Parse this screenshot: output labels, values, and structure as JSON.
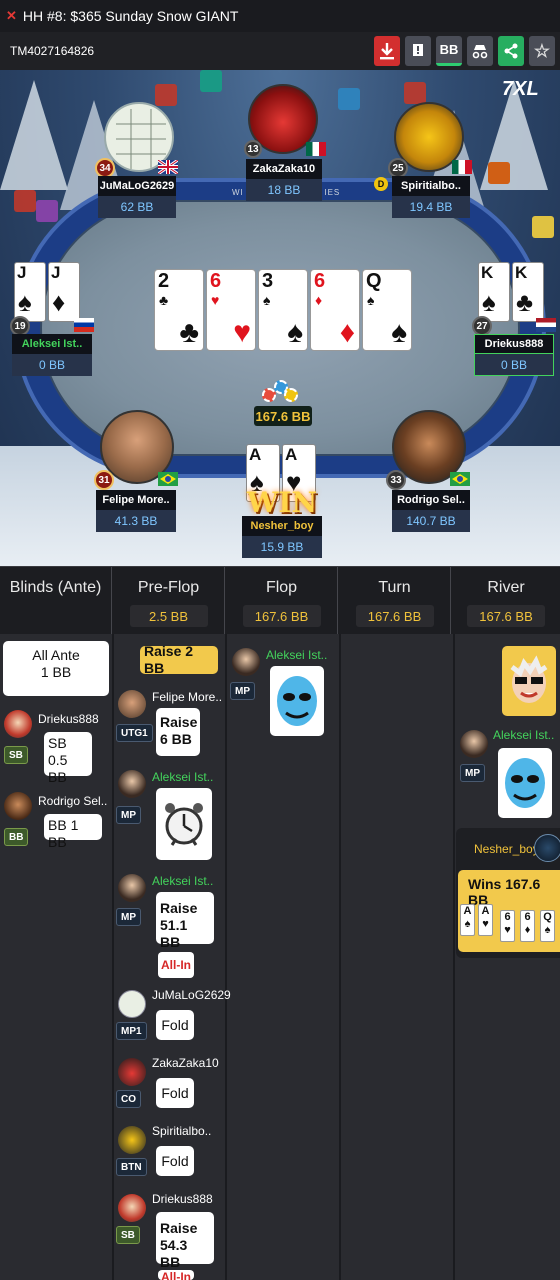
{
  "title": {
    "text": "HH  #8: $365 Sunday Snow GIANT"
  },
  "toolbar": {
    "tournament_id": "TM4027164826",
    "bb_label": "BB"
  },
  "brand": {
    "logo_text": "7XL"
  },
  "table": {
    "banner_partial": "WI                         IES",
    "board": [
      {
        "rank": "2",
        "suit": "♣",
        "color": "black"
      },
      {
        "rank": "6",
        "suit": "♥",
        "color": "red"
      },
      {
        "rank": "3",
        "suit": "♠",
        "color": "black"
      },
      {
        "rank": "6",
        "suit": "♦",
        "color": "red"
      },
      {
        "rank": "Q",
        "suit": "♠",
        "color": "black"
      }
    ],
    "pot": "167.6 BB",
    "win_label": "WIN",
    "seats": [
      {
        "name": "JuMaLoG2629",
        "stack": "62 BB",
        "level": "34"
      },
      {
        "name": "ZakaZaka10",
        "stack": "18 BB",
        "level": "13"
      },
      {
        "name": "Spiritialbo..",
        "stack": "19.4 BB",
        "level": "25",
        "dealer": "D"
      },
      {
        "name": "Aleksei Ist..",
        "stack": "0 BB",
        "level": "19",
        "cards": [
          {
            "rank": "J",
            "suit": "♠"
          },
          {
            "rank": "J",
            "suit": "♦"
          }
        ]
      },
      {
        "name": "Driekus888",
        "stack": "0 BB",
        "level": "27",
        "cards": [
          {
            "rank": "K",
            "suit": "♠"
          },
          {
            "rank": "K",
            "suit": "♣"
          }
        ]
      },
      {
        "name": "Felipe More..",
        "stack": "41.3 BB",
        "level": "31"
      },
      {
        "name": "Nesher_boy",
        "stack": "15.9 BB",
        "cards": [
          {
            "rank": "A",
            "suit": "♠"
          },
          {
            "rank": "A",
            "suit": "♥"
          }
        ]
      },
      {
        "name": "Rodrigo Sel..",
        "stack": "140.7 BB",
        "level": "33"
      }
    ]
  },
  "streets": {
    "headers": [
      {
        "label": "Blinds (Ante)",
        "pot": ""
      },
      {
        "label": "Pre-Flop",
        "pot": "2.5 BB"
      },
      {
        "label": "Flop",
        "pot": "167.6 BB"
      },
      {
        "label": "Turn",
        "pot": "167.6 BB"
      },
      {
        "label": "River",
        "pot": "167.6 BB"
      }
    ],
    "blinds": {
      "ante_title": "All Ante",
      "ante_value": "1 BB",
      "sb": {
        "name": "Driekus888",
        "pos": "SB",
        "line1": "SB",
        "line2": "0.5 BB"
      },
      "bb": {
        "name": "Rodrigo Sel..",
        "pos": "BB",
        "text": "BB 1 BB"
      }
    },
    "preflop": {
      "open": "Raise 2 BB",
      "actions": [
        {
          "name": "Felipe More..",
          "pos": "UTG1",
          "line1": "Raise",
          "line2": "6 BB"
        },
        {
          "name": "Aleksei Ist..",
          "pos": "MP"
        },
        {
          "name": "Aleksei Ist..",
          "pos": "MP",
          "line1": "Raise",
          "line2": "51.1 BB",
          "tag": "All-In"
        },
        {
          "name": "JuMaLoG2629",
          "pos": "MP1",
          "line1": "Fold"
        },
        {
          "name": "ZakaZaka10",
          "pos": "CO",
          "line1": "Fold"
        },
        {
          "name": "Spiritialbo..",
          "pos": "BTN",
          "line1": "Fold"
        },
        {
          "name": "Driekus888",
          "pos": "SB",
          "line1": "Raise",
          "line2": "54.3 BB",
          "tag": "All-In"
        }
      ]
    },
    "flop": {
      "name": "Aleksei Ist..",
      "pos": "MP"
    },
    "river": {
      "name": "Aleksei Ist..",
      "pos": "MP",
      "winner": "Nesher_boy",
      "wins": "Wins 167.6 BB",
      "cards": [
        {
          "rank": "A",
          "suit": "♠",
          "color": "black"
        },
        {
          "rank": "A",
          "suit": "♥",
          "color": "red"
        },
        {
          "rank": "6",
          "suit": "♥",
          "color": "red"
        },
        {
          "rank": "6",
          "suit": "♦",
          "color": "red"
        },
        {
          "rank": "Q",
          "suit": "♠",
          "color": "black"
        }
      ]
    }
  }
}
